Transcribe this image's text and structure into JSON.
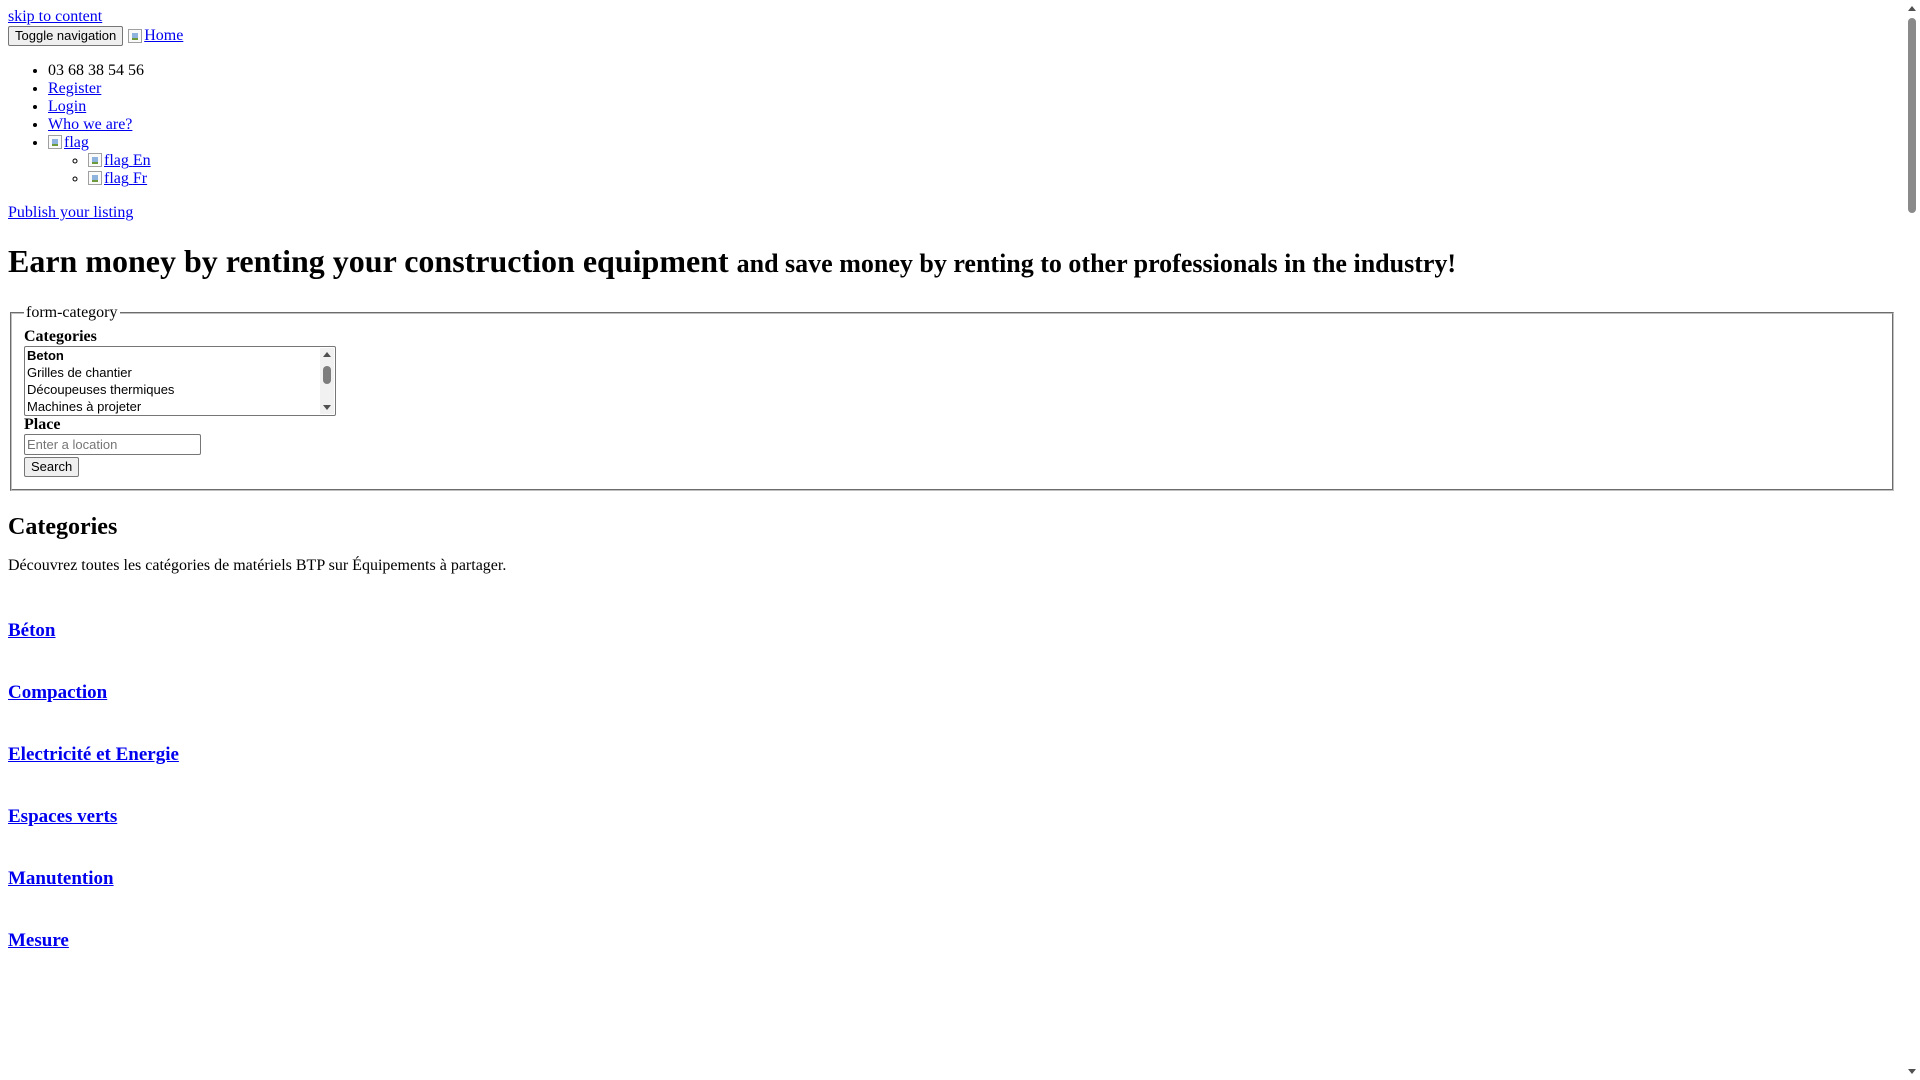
{
  "skip_link": "skip to content",
  "header": {
    "toggle_label": "Toggle navigation",
    "home_alt": "Home"
  },
  "nav": {
    "phone": "03 68 38 54 56",
    "register": "Register",
    "login": "Login",
    "who": "Who we are?",
    "flag_alt": "flag",
    "languages": [
      {
        "alt": "flag",
        "label": "En"
      },
      {
        "alt": "flag",
        "label": "Fr"
      }
    ]
  },
  "publish_link": "Publish your listing",
  "hero": {
    "title": "Earn money by renting your construction equipment",
    "subtitle": "and save money by renting to other professionals in the industry!"
  },
  "search_form": {
    "legend": "form-category",
    "categories_label": "Categories",
    "category_options": [
      "Beton",
      "Grilles de chantier",
      "Découpeuses thermiques",
      "Machines à projeter"
    ],
    "selected_option": "Beton",
    "place_label": "Place",
    "place_placeholder": "Enter a location",
    "search_button": "Search"
  },
  "categories_section": {
    "title": "Categories",
    "description": "Découvrez toutes les catégories de matériels BTP sur Équipements à partager.",
    "items": [
      "Béton",
      "Compaction",
      "Electricité et Energie",
      "Espaces verts",
      "Manutention",
      "Mesure"
    ]
  }
}
